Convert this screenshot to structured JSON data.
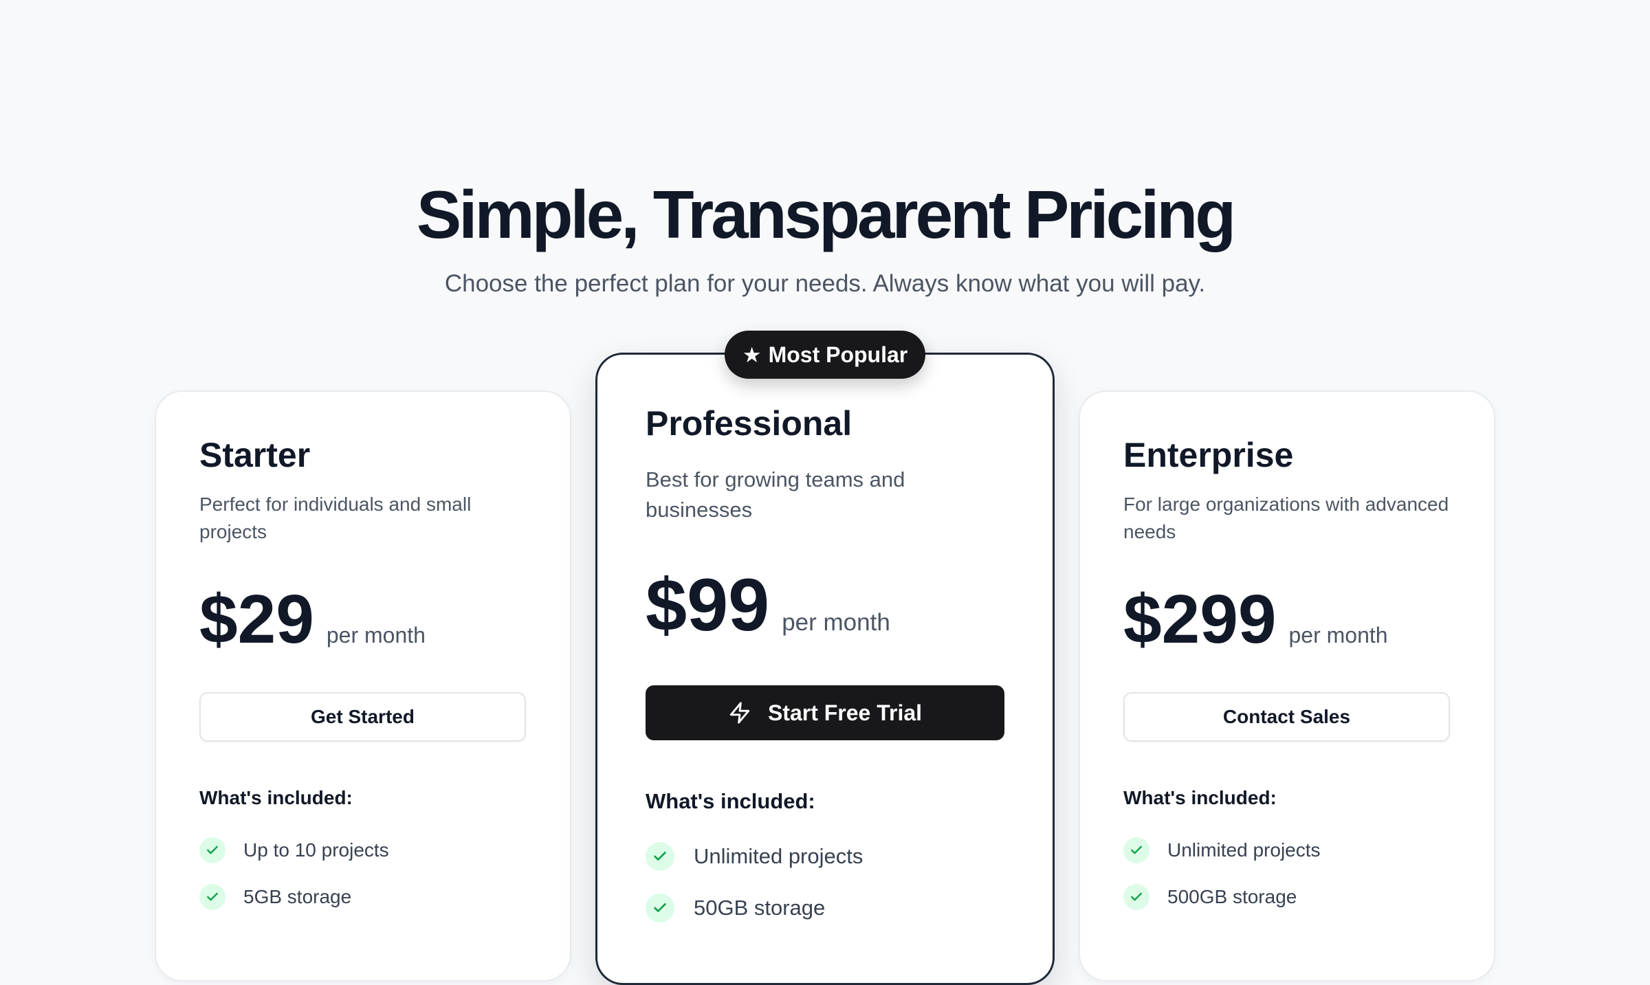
{
  "hero": {
    "title": "Simple, Transparent Pricing",
    "subtitle": "Choose the perfect plan for your needs. Always know what you will pay."
  },
  "plans": [
    {
      "name": "Starter",
      "description": "Perfect for individuals and small projects",
      "price": "$29",
      "period": "per month",
      "button_label": "Get Started",
      "included_heading": "What's included:",
      "features": [
        "Up to 10 projects",
        "5GB storage"
      ]
    },
    {
      "name": "Professional",
      "description": "Best for growing teams and businesses",
      "price": "$99",
      "period": "per month",
      "button_label": "Start Free Trial",
      "button_icon": "bolt-icon",
      "included_heading": "What's included:",
      "features": [
        "Unlimited projects",
        "50GB storage"
      ],
      "badge": {
        "label": "Most Popular",
        "icon": "star-icon"
      }
    },
    {
      "name": "Enterprise",
      "description": "For large organizations with advanced needs",
      "price": "$299",
      "period": "per month",
      "button_label": "Contact Sales",
      "included_heading": "What's included:",
      "features": [
        "Unlimited projects",
        "500GB storage"
      ]
    }
  ],
  "colors": {
    "background": "#f8f9fb",
    "text_primary": "#111827",
    "text_secondary": "#4b5563",
    "accent_dark": "#18181b",
    "check_background": "#dcfce7",
    "check_color": "#16a34a"
  }
}
